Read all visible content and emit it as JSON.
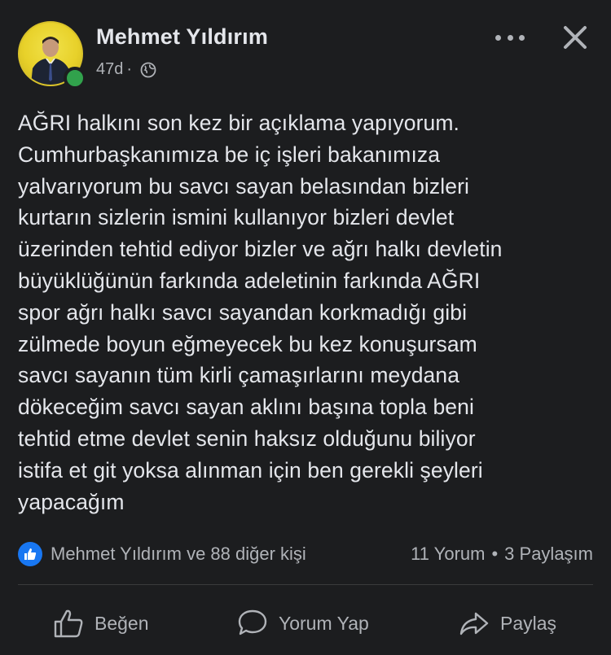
{
  "post": {
    "author": "Mehmet Yıldırım",
    "time": "47d",
    "time_separator": "·",
    "text": "AĞRI halkını son kez bir açıklama yapıyorum.\nCumhurbaşkanımıza be iç işleri bakanımıza\nyalvarıyorum bu savcı sayan belasından bizleri\nkurtarın sizlerin ismini kullanıyor bizleri devlet\nüzerinden tehtid ediyor bizler ve ağrı halkı devletin\nbüyüklüğünün farkında adeletinin farkında AĞRI\nspor ağrı halkı savcı sayandan korkmadığı gibi\nzülmede boyun eğmeyecek bu kez konuşursam\nsavcı sayanın tüm kirli çamaşırlarını meydana\ndökeceğim savcı sayan aklını başına topla beni\ntehtid etme devlet senin haksız olduğunu biliyor\nistifa et git yoksa alınman için ben gerekli şeyleri\nyapacağım",
    "privacy_icon": "globe-icon",
    "online": true
  },
  "reactions": {
    "summary": "Mehmet Yıldırım ve 88 diğer kişi",
    "icon": "like-icon",
    "comments": "11 Yorum",
    "separator": "•",
    "shares": "3 Paylaşım"
  },
  "actions": {
    "like_label": "Beğen",
    "comment_label": "Yorum Yap",
    "share_label": "Paylaş"
  },
  "colors": {
    "background": "#1c1d1f",
    "text": "#e4e6eb",
    "secondary": "#b0b3b8",
    "like_blue": "#1877f2",
    "online_green": "#31a24c",
    "avatar_yellow": "#e8d12a"
  }
}
